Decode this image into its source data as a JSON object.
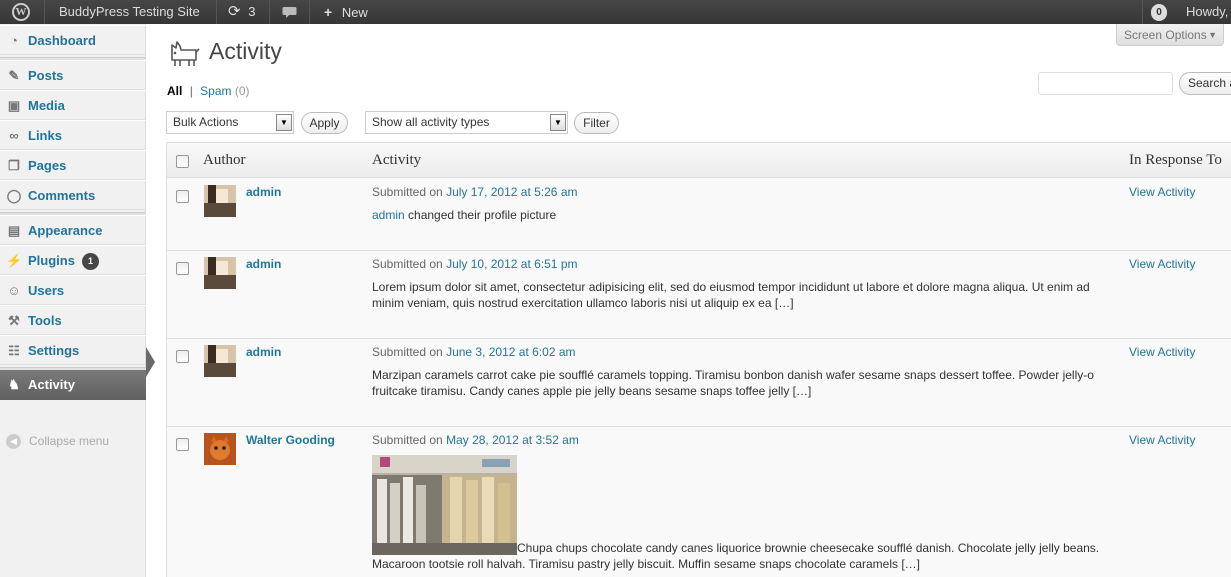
{
  "adminbar": {
    "site_name": "BuddyPress Testing Site",
    "updates_count": "3",
    "new_label": "New",
    "notif_count": "0",
    "howdy": "Howdy,"
  },
  "sidebar": {
    "items": [
      {
        "label": "Dashboard",
        "icon": "dashboard-icon"
      },
      {
        "label": "Posts",
        "icon": "pushpin-icon"
      },
      {
        "label": "Media",
        "icon": "media-icon"
      },
      {
        "label": "Links",
        "icon": "link-icon"
      },
      {
        "label": "Pages",
        "icon": "pages-icon"
      },
      {
        "label": "Comments",
        "icon": "comment-icon"
      },
      {
        "label": "Appearance",
        "icon": "brush-icon"
      },
      {
        "label": "Plugins",
        "icon": "plug-icon",
        "badge": "1"
      },
      {
        "label": "Users",
        "icon": "users-icon"
      },
      {
        "label": "Tools",
        "icon": "tools-icon"
      },
      {
        "label": "Settings",
        "icon": "settings-icon"
      },
      {
        "label": "Activity",
        "icon": "activity-icon"
      }
    ],
    "collapse_label": "Collapse menu"
  },
  "header": {
    "screen_options": "Screen Options",
    "title": "Activity",
    "filter_all": "All",
    "filter_sep": "|",
    "filter_spam": "Spam",
    "filter_spam_count": "(0)",
    "search_button": "Search a"
  },
  "toolbar": {
    "bulk_actions": "Bulk Actions",
    "apply": "Apply",
    "activity_types": "Show all activity types",
    "filter": "Filter"
  },
  "table": {
    "columns": [
      "Author",
      "Activity",
      "In Response To"
    ],
    "rows": [
      {
        "author": "admin",
        "submitted_prefix": "Submitted on",
        "date": "July 17, 2012 at 5:26 am",
        "user_link": "admin",
        "text": "changed their profile picture",
        "response": "View Activity"
      },
      {
        "author": "admin",
        "submitted_prefix": "Submitted on",
        "date": "July 10, 2012 at 6:51 pm",
        "text": "Lorem ipsum dolor sit amet, consectetur adipisicing elit, sed do eiusmod tempor incididunt ut labore et dolore magna aliqua. Ut enim ad minim veniam, quis nostrud exercitation ullamco laboris nisi ut aliquip ex ea […]",
        "response": "View Activity"
      },
      {
        "author": "admin",
        "submitted_prefix": "Submitted on",
        "date": "June 3, 2012 at 6:02 am",
        "text": "Marzipan caramels carrot cake pie soufflé caramels topping. Tiramisu bonbon danish wafer sesame snaps dessert toffee. Powder jelly-o fruitcake tiramisu. Candy canes apple pie jelly beans sesame snaps toffee jelly […]",
        "response": "View Activity"
      },
      {
        "author": "Walter Gooding",
        "submitted_prefix": "Submitted on",
        "date": "May 28, 2012 at 3:52 am",
        "text": "Chupa chups chocolate candy canes liquorice brownie cheesecake soufflé danish. Chocolate jelly jelly beans. Macaroon tootsie roll halvah. Tiramisu pastry jelly biscuit. Muffin sesame snaps chocolate caramels […]",
        "response": "View Activity"
      }
    ]
  },
  "colors": {
    "link": "#21759b",
    "adminbar": "#464646",
    "active_menu": "#6a6a6a"
  }
}
